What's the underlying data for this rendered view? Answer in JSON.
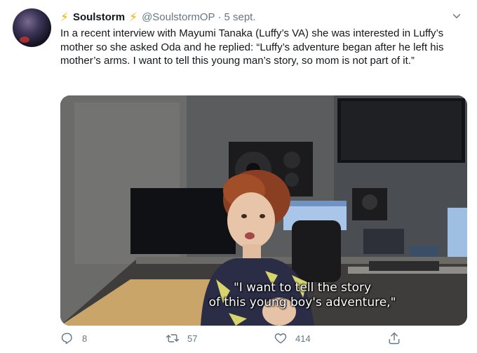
{
  "tweet": {
    "display_name": "Soulstorm",
    "name_emoji": "⚡",
    "handle": "@SoulstormOP",
    "separator": "·",
    "date": "5 sept.",
    "text": "In a recent interview with Mayumi Tanaka (Luffy’s VA) she was interested in Luffy’s mother so she asked Oda and he replied: “Luffy’s adventure began after he left his mother’s arms. I want to tell this young man’s story, so mom is not part of it.”",
    "media": {
      "subtitle_line1": "\"I want to tell the story",
      "subtitle_line2": "of this young boy's adventure,\""
    }
  },
  "actions": {
    "reply_count": "8",
    "retweet_count": "57",
    "like_count": "414",
    "icons": [
      "reply-icon",
      "retweet-icon",
      "like-icon",
      "share-icon"
    ]
  },
  "colors": {
    "text": "#14171a",
    "muted": "#657786",
    "bolt": "#f5b400"
  }
}
